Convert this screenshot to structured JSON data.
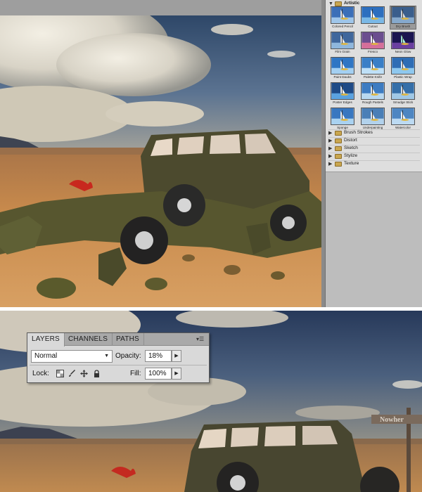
{
  "filter_gallery": {
    "expanded_category": "Artistic",
    "thumbnails": [
      {
        "label": "Colored Pencil",
        "selected": false
      },
      {
        "label": "Cutout",
        "selected": false
      },
      {
        "label": "Dry Brush",
        "selected": true
      },
      {
        "label": "Film Grain",
        "selected": false
      },
      {
        "label": "Fresco",
        "selected": false
      },
      {
        "label": "Neon Glow",
        "selected": false
      },
      {
        "label": "Paint Daubs",
        "selected": false
      },
      {
        "label": "Palette Knife",
        "selected": false
      },
      {
        "label": "Plastic Wrap",
        "selected": false
      },
      {
        "label": "Poster Edges",
        "selected": false
      },
      {
        "label": "Rough Pastels",
        "selected": false
      },
      {
        "label": "Smudge Stick",
        "selected": false
      },
      {
        "label": "Sponge",
        "selected": false
      },
      {
        "label": "Underpainting",
        "selected": false
      },
      {
        "label": "Watercolor",
        "selected": false
      }
    ],
    "collapsed_categories": [
      "Brush Strokes",
      "Distort",
      "Sketch",
      "Stylize",
      "Texture"
    ]
  },
  "layers_panel": {
    "tabs": [
      "LAYERS",
      "CHANNELS",
      "PATHS"
    ],
    "active_tab": "LAYERS",
    "blend_mode": "Normal",
    "opacity_label": "Opacity:",
    "opacity_value": "18%",
    "lock_label": "Lock:",
    "fill_label": "Fill:",
    "fill_value": "100%"
  },
  "scene": {
    "signpost_text": "Nowher"
  },
  "colors": {
    "panel_bg": "#d9d9d9",
    "gallery_bg": "#dedede",
    "selected_thumb": "#9a9a9a",
    "sky_blue": "#3d5a7e",
    "desert": "#b87a42"
  }
}
